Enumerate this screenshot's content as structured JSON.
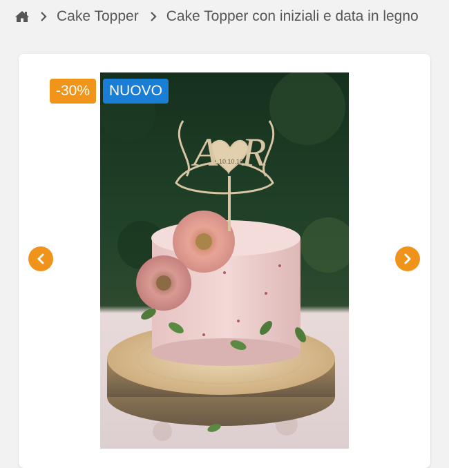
{
  "breadcrumb": {
    "home_icon": "home-icon",
    "separator_icon": "chevron-right-icon",
    "items": [
      {
        "label": "Cake Topper"
      },
      {
        "label": "Cake Topper con iniziali e data in legno"
      }
    ]
  },
  "product": {
    "badges": {
      "discount": "-30%",
      "new": "NUOVO"
    },
    "image": {
      "topper_initials_left": "A",
      "topper_initials_right": "R",
      "topper_date": "10.10.16"
    },
    "carousel": {
      "prev_icon": "chevron-left-icon",
      "next_icon": "chevron-right-icon"
    }
  },
  "colors": {
    "accent_orange": "#f0931a",
    "badge_blue": "#1a7fd4",
    "page_background": "#f2f2f2"
  }
}
